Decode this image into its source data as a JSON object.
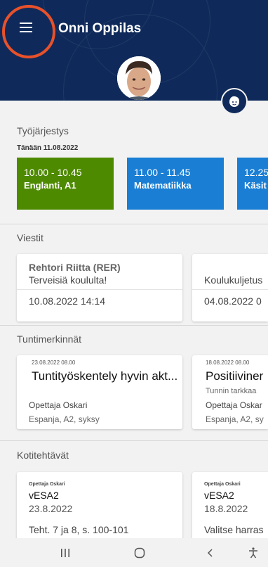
{
  "header": {
    "user_name": "Onni Oppilas",
    "color": "#0f2a5a",
    "highlight_color": "#e8512a"
  },
  "schedule": {
    "title": "Työjärjestys",
    "date_label": "Tänään 11.08.2022",
    "lessons": [
      {
        "time": "10.00 - 10.45",
        "subject": "Englanti, A1",
        "color": "#4e8a00"
      },
      {
        "time": "11.00 - 11.45",
        "subject": "Matematiikka",
        "color": "#1a7fd4"
      },
      {
        "time": "12.25",
        "subject": "Käsit",
        "color": "#1a7fd4"
      }
    ]
  },
  "messages": {
    "title": "Viestit",
    "items": [
      {
        "sender": "Rehtori Riitta (RER)",
        "text": "Terveisiä koululta!",
        "date": "10.08.2022 14:14"
      },
      {
        "sender": "",
        "text": "Koulukuljetus",
        "date": "04.08.2022 0"
      }
    ]
  },
  "lesson_marks": {
    "title": "Tuntimerkinnät",
    "items": [
      {
        "date": "23.08.2022 08.00",
        "title": "Tuntityöskentely hyvin akt...",
        "subtitle": "",
        "teacher": "Opettaja Oskari",
        "course": "Espanja, A2, syksy"
      },
      {
        "date": "18.08.2022 08.00",
        "title": "Positiiviner",
        "subtitle": "Tunnin tarkkaa",
        "teacher": "Opettaja Oskar",
        "course": "Espanja, A2, sy"
      }
    ]
  },
  "homework": {
    "title": "Kotitehtävät",
    "items": [
      {
        "teacher": "Opettaja Oskari",
        "title": "vESA2",
        "date": "23.8.2022",
        "text": "Teht. 7 ja 8, s. 100-101"
      },
      {
        "teacher": "Opettaja Oskari",
        "title": "vESA2",
        "date": "18.8.2022",
        "text": "Valitse harras"
      }
    ]
  },
  "icons": {
    "menu": "menu-icon",
    "fab": "student-face-icon",
    "nav_recents": "recents-icon",
    "nav_home": "home-icon",
    "nav_back": "back-icon",
    "nav_accessibility": "accessibility-icon"
  }
}
